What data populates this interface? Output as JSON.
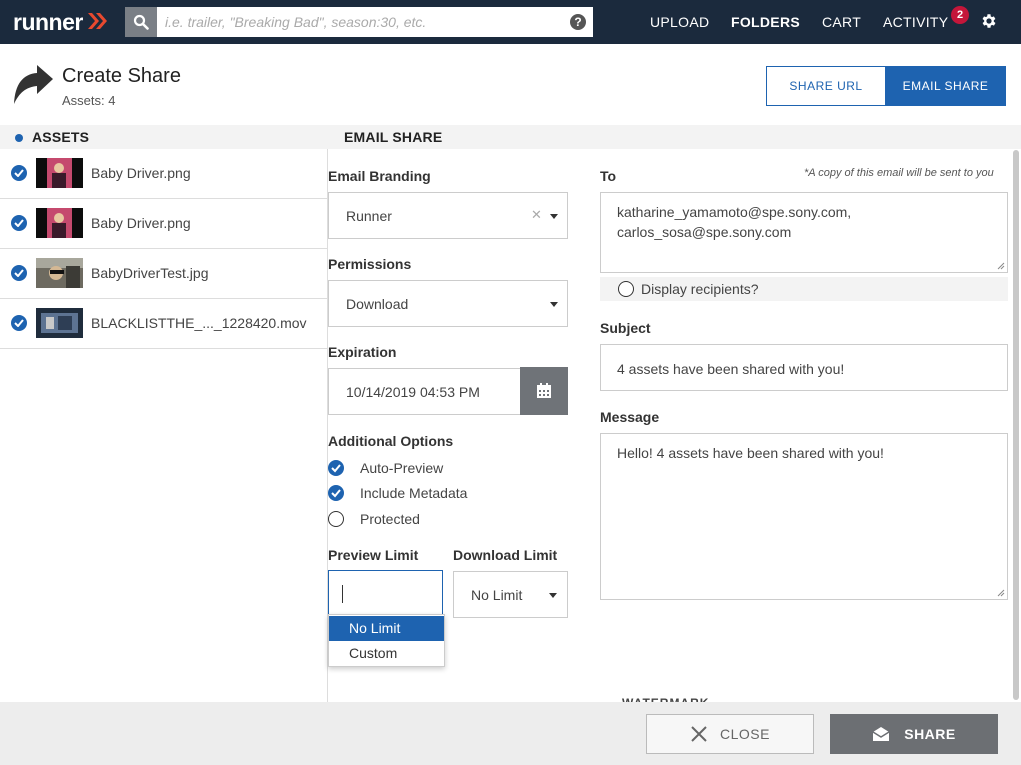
{
  "nav": {
    "logo": "runner",
    "search_placeholder": "i.e. trailer, \"Breaking Bad\", season:30, etc.",
    "help": "?",
    "items": [
      {
        "label": "UPLOAD"
      },
      {
        "label": "FOLDERS"
      },
      {
        "label": "CART"
      },
      {
        "label": "ACTIVITY"
      }
    ],
    "activity_badge": "2"
  },
  "header": {
    "title": "Create Share",
    "assets_count": "Assets: 4",
    "share_url_label": "SHARE URL",
    "email_share_label": "EMAIL SHARE"
  },
  "sections": {
    "assets": "ASSETS",
    "email_share": "EMAIL SHARE"
  },
  "assets": [
    {
      "name": "Baby Driver.png",
      "checked": true
    },
    {
      "name": "Baby Driver.png",
      "checked": true
    },
    {
      "name": "BabyDriverTest.jpg",
      "checked": true
    },
    {
      "name": "BLACKLISTTHE_..._1228420.mov",
      "checked": true
    }
  ],
  "form": {
    "branding_label": "Email Branding",
    "branding_value": "Runner",
    "permissions_label": "Permissions",
    "permissions_value": "Download",
    "expiration_label": "Expiration",
    "expiration_value": "10/14/2019 04:53 PM",
    "additional_label": "Additional Options",
    "options": [
      {
        "label": "Auto-Preview",
        "checked": true
      },
      {
        "label": "Include Metadata",
        "checked": true
      },
      {
        "label": "Protected",
        "checked": false
      }
    ],
    "preview_limit_label": "Preview Limit",
    "preview_limit_value": "",
    "preview_dropdown": [
      "No Limit",
      "Custom"
    ],
    "download_limit_label": "Download Limit",
    "download_limit_value": "No Limit"
  },
  "email": {
    "to_label": "To",
    "copy_note": "*A copy of this email will be sent to you",
    "to_lines": [
      "katharine_yamamoto@spe.sony.com,",
      "carlos_sosa@spe.sony.com"
    ],
    "display_recipients": "Display recipients?",
    "subject_label": "Subject",
    "subject_value": "4 assets have been shared with you!",
    "message_label": "Message",
    "message_value": "Hello! 4 assets have been shared with you!",
    "watermark_label": "WATERMARK"
  },
  "footer": {
    "close_label": "CLOSE",
    "share_label": "SHARE"
  },
  "colors": {
    "nav_bg": "#1b2a3d",
    "accent": "#1e63b0",
    "badge": "#c4163a",
    "share_btn": "#6c6f73"
  }
}
